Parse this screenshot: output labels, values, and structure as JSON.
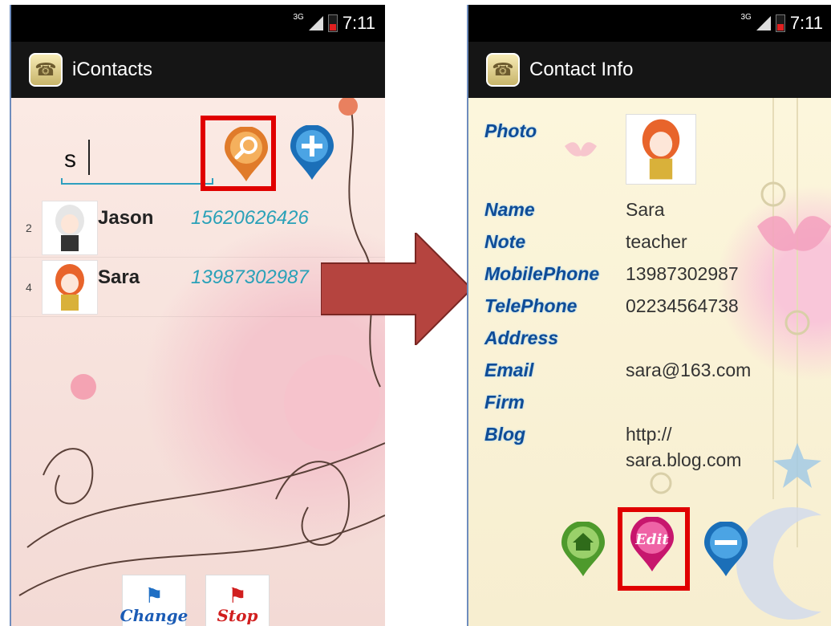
{
  "left_screen": {
    "status": {
      "network": "3G",
      "time": "7:11"
    },
    "title": "iContacts",
    "search": {
      "value": "s",
      "placeholder": ""
    },
    "contacts": [
      {
        "index": "2",
        "name": "Jason",
        "phone": "15620626426",
        "avatar": "girl-white-hair-avatar"
      },
      {
        "index": "4",
        "name": "Sara",
        "phone": "13987302987",
        "avatar": "girl-orange-hair-avatar"
      }
    ],
    "buttons": {
      "search_icon": "search-icon",
      "add_icon": "add-icon",
      "change_label": "Change",
      "stop_label": "Stop"
    }
  },
  "right_screen": {
    "status": {
      "network": "3G",
      "time": "7:11"
    },
    "title": "Contact Info",
    "fields": [
      {
        "label": "Photo",
        "value": ""
      },
      {
        "label": "Name",
        "value": "Sara"
      },
      {
        "label": "Note",
        "value": "teacher"
      },
      {
        "label": "MobilePhone",
        "value": "13987302987"
      },
      {
        "label": "TelePhone",
        "value": "02234564738"
      },
      {
        "label": "Address",
        "value": ""
      },
      {
        "label": "Email",
        "value": "sara@163.com"
      },
      {
        "label": "Firm",
        "value": ""
      },
      {
        "label": "Blog",
        "value": "http://\nsara.blog.com"
      }
    ],
    "blog_line1": "http://",
    "blog_line2": "sara.blog.com",
    "buttons": {
      "home_icon": "home-icon",
      "edit_label": "Edit",
      "remove_icon": "minus-icon"
    }
  },
  "colors": {
    "highlight": "#e00000",
    "arrow": "#b5443f",
    "label_blue": "#0f4c96",
    "phone_teal": "#2aa1b8"
  }
}
